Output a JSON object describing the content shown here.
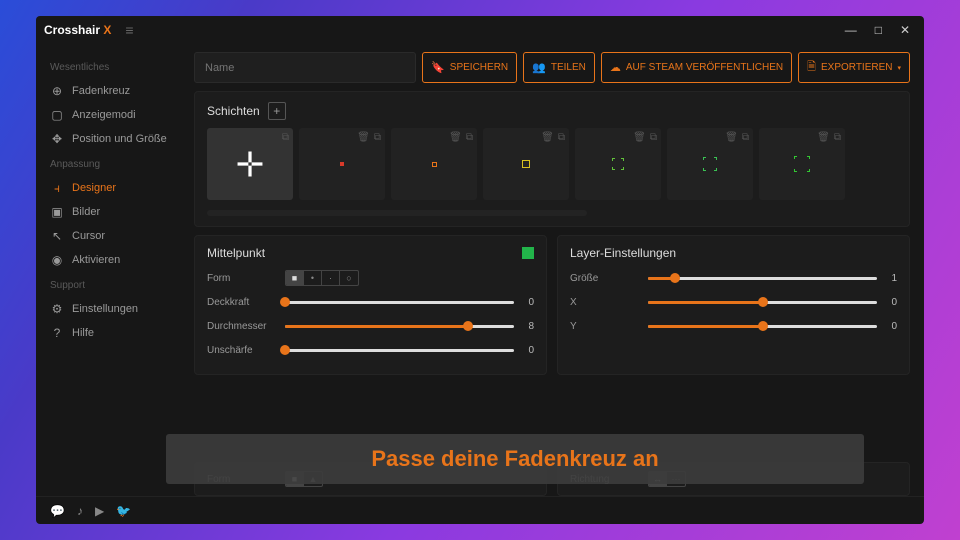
{
  "title": {
    "brand": "Crosshair",
    "accent": "X"
  },
  "sidebar": {
    "sections": [
      {
        "label": "Wesentliches",
        "items": [
          {
            "icon": "⊕",
            "label": "Fadenkreuz"
          },
          {
            "icon": "▢",
            "label": "Anzeigemodi"
          },
          {
            "icon": "✥",
            "label": "Position und Größe"
          }
        ]
      },
      {
        "label": "Anpassung",
        "items": [
          {
            "icon": "⫞",
            "label": "Designer",
            "active": true
          },
          {
            "icon": "▣",
            "label": "Bilder"
          },
          {
            "icon": "↖",
            "label": "Cursor"
          },
          {
            "icon": "◉",
            "label": "Aktivieren"
          }
        ]
      },
      {
        "label": "Support",
        "items": [
          {
            "icon": "⚙",
            "label": "Einstellungen"
          },
          {
            "icon": "?",
            "label": "Hilfe"
          }
        ]
      }
    ]
  },
  "toolbar": {
    "name_placeholder": "Name",
    "save": "SPEICHERN",
    "share": "TEILEN",
    "publish": "AUF STEAM VERÖFFENTLICHEN",
    "export": "EXPORTIEREN"
  },
  "layers": {
    "title": "Schichten",
    "tiles": [
      {
        "kind": "cross",
        "color": "#fff",
        "selected": true
      },
      {
        "kind": "dot-solid",
        "color": "#d83a2a"
      },
      {
        "kind": "dot-hollow",
        "color": "#e8741a"
      },
      {
        "kind": "hollow-sq",
        "color": "#d8c220"
      },
      {
        "kind": "corners",
        "color": "#62c23a"
      },
      {
        "kind": "corners-spread",
        "color": "#3ac253"
      },
      {
        "kind": "corners-wide",
        "color": "#32c832"
      }
    ]
  },
  "center": {
    "title": "Mittelpunkt",
    "form_label": "Form",
    "form_options": [
      "■",
      "•",
      "·",
      "○"
    ],
    "form_selected": 0,
    "sliders": [
      {
        "label": "Deckkraft",
        "value": 0,
        "max": 10
      },
      {
        "label": "Durchmesser",
        "value": 8,
        "max": 10
      },
      {
        "label": "Unschärfe",
        "value": 0,
        "max": 10
      }
    ]
  },
  "layer_settings": {
    "title": "Layer-Einstellungen",
    "sliders": [
      {
        "label": "Größe",
        "value": 1,
        "max": 10,
        "fillpct": 12
      },
      {
        "label": "X",
        "value": 0,
        "max": 10,
        "fillpct": 50
      },
      {
        "label": "Y",
        "value": 0,
        "max": 10,
        "fillpct": 50
      }
    ]
  },
  "bottom": {
    "form_label": "Form",
    "direction_label": "Richtung"
  },
  "caption": "Passe deine Fadenkreuz an"
}
